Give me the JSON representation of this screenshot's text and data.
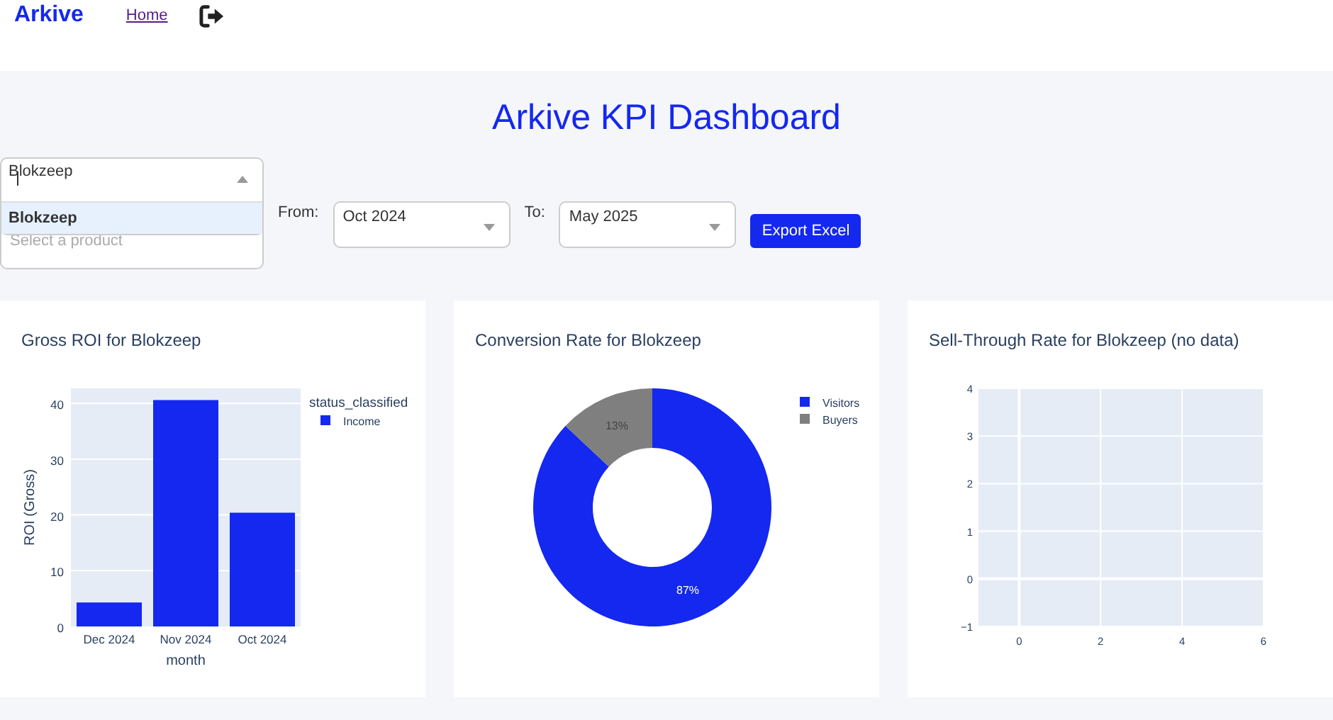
{
  "nav": {
    "brand": "Arkive",
    "links": [
      {
        "label": "Home"
      }
    ]
  },
  "title": "Arkive KPI Dashboard",
  "product_select": {
    "placeholder": "Select a product",
    "expanded": true,
    "search_value": "Blokzeep",
    "options": [
      {
        "label": "Blokzeep",
        "selected": true
      }
    ]
  },
  "from": {
    "label": "From:",
    "value": "Oct 2024"
  },
  "to": {
    "label": "To:",
    "value": "May 2025"
  },
  "export_button": "Export Excel",
  "cards": [
    {
      "title": "Gross ROI for Blokzeep",
      "chart_data": {
        "type": "bar",
        "xlabel": "month",
        "ylabel": "ROI (Gross)",
        "categories": [
          "Dec 2024",
          "Nov 2024",
          "Oct 2024"
        ],
        "legend_title": "status_classified",
        "series": [
          {
            "name": "Income",
            "color": "#1428f0",
            "values": [
              4.3,
              40.6,
              20.4
            ]
          }
        ],
        "ylim": [
          0,
          42.7
        ],
        "yticks": [
          0,
          10,
          20,
          30,
          40
        ],
        "grid": true,
        "legend": "right"
      }
    },
    {
      "title": "Conversion Rate for Blokzeep",
      "chart_data": {
        "type": "donut",
        "categories": [
          "Visitors",
          "Buyers"
        ],
        "values": [
          87,
          13
        ],
        "colors": [
          "#1428f0",
          "#7f7f7f"
        ],
        "value_labels": [
          "87%",
          "13%"
        ],
        "legend": "right"
      }
    },
    {
      "title": "Sell-Through Rate for Blokzeep (no data)",
      "chart_data": {
        "type": "line",
        "xlim": [
          -1,
          6
        ],
        "ylim": [
          -1,
          4
        ],
        "xticks": [
          0,
          2,
          4,
          6
        ],
        "yticks": [
          {
            "value": -1,
            "label": "−1"
          },
          0,
          1,
          2,
          3,
          4
        ],
        "grid": true
      }
    }
  ]
}
